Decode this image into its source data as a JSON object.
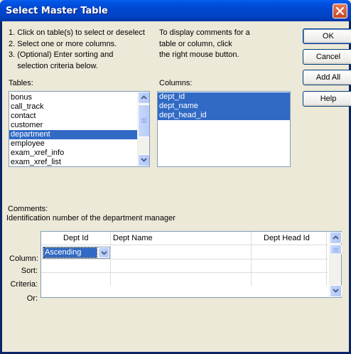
{
  "window": {
    "title": "Select Master Table"
  },
  "instructions": {
    "left": [
      "1. Click on table(s) to select or deselect",
      "2. Select one or more columns.",
      "3. (Optional) Enter sorting and",
      "    selection criteria below."
    ],
    "right": [
      "To display comments for a",
      "table or column, click",
      "the right mouse button."
    ]
  },
  "buttons": {
    "ok": "OK",
    "cancel": "Cancel",
    "add_all": "Add All",
    "help": "Help"
  },
  "tables": {
    "label": "Tables:",
    "items": [
      "bonus",
      "call_track",
      "contact",
      "customer",
      "department",
      "employee",
      "exam_xref_info",
      "exam_xref_list"
    ],
    "selected": "department"
  },
  "columns": {
    "label": "Columns:",
    "items": [
      "dept_id",
      "dept_name",
      "dept_head_id"
    ]
  },
  "comments": {
    "label": "Comments:",
    "text": "Identification number of the department manager"
  },
  "grid": {
    "row_labels": {
      "column": "Column:",
      "sort": "Sort:",
      "criteria": "Criteria:",
      "or": "Or:"
    },
    "headers": [
      "Dept Id",
      "Dept Name",
      "Dept Head Id"
    ],
    "sort_value": "Ascending"
  }
}
